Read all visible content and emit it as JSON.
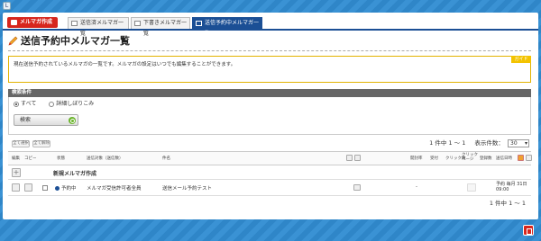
{
  "topbar": {
    "logo": "L"
  },
  "toolbar": {
    "create_label": "メルマガ作成"
  },
  "tabs": [
    {
      "label": "送信済メルマガ一覧"
    },
    {
      "label": "下書きメルマガ一覧"
    },
    {
      "label": "送信予約中メルマガ一覧"
    }
  ],
  "page": {
    "title": "送信予約中メルマガ一覧"
  },
  "notice": {
    "text": "現在送信予約されているメルマガの一覧です。メルマガの設定はいつでも編集することができます。",
    "hide_label": "ガイド"
  },
  "search": {
    "header": "検索条件",
    "radio_all": "すべて",
    "radio_detail": "詳細しぼりこみ",
    "button": "検索"
  },
  "selection": {
    "select_all": "全て選択",
    "clear_all": "全て解除"
  },
  "pager": {
    "summary": "1 件中 1 ～ 1",
    "per_page_label": "表示件数：",
    "per_page_value": "30",
    "bottom_summary": "1 件中 1 ～ 1"
  },
  "table": {
    "headers": {
      "edit": "編集",
      "copy": "コピー",
      "status": "状態",
      "target": "送信対象（送信数）",
      "subject": "件名",
      "open": "開封率",
      "delivered": "受付",
      "click": "クリック数",
      "clickpage": "クリックページ",
      "bounce": "登録数",
      "send_date": "送信日時"
    },
    "new_row_label": "新規メルマガ作成",
    "rows": [
      {
        "status": "予約中",
        "target": "メルマガ受信許可者全員",
        "subject": "送信メール予約テスト",
        "open": "-",
        "send_date": "予約 毎月 31日 09:00"
      }
    ]
  },
  "colors": {
    "brand_red": "#d7261d",
    "nav_blue": "#1b4f95",
    "notice_yellow": "#e2b300"
  }
}
